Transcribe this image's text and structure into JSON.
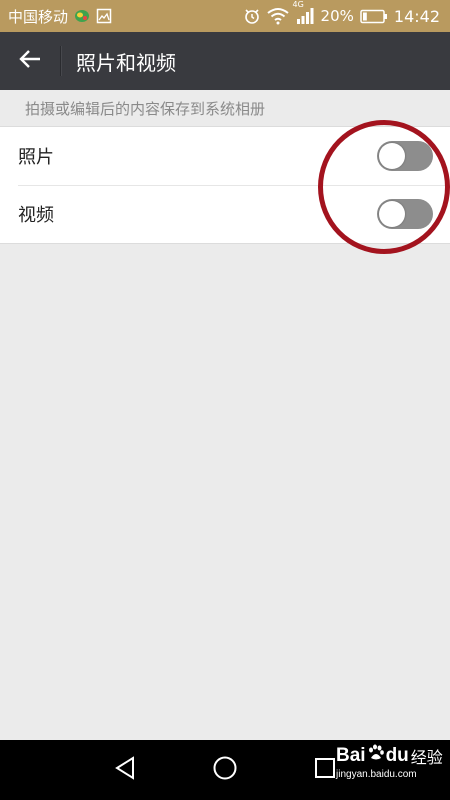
{
  "status_bar": {
    "carrier": "中国移动",
    "network_label": "4G",
    "battery_percent": "20%",
    "battery_level": 0.2,
    "time": "14:42"
  },
  "app_bar": {
    "back_icon": "arrow-left",
    "title": "照片和视频"
  },
  "section_hint": "拍摄或编辑后的内容保存到系统相册",
  "settings": [
    {
      "label": "照片",
      "enabled": false
    },
    {
      "label": "视频",
      "enabled": false
    }
  ],
  "annotation": {
    "color": "#a3131e"
  },
  "nav_bar": {
    "back_icon": "triangle-back",
    "home_icon": "circle-home",
    "recents_icon": "square-recents"
  },
  "watermark": {
    "brand_left": "Bai",
    "brand_right": "du",
    "brand_cn": "经验",
    "url": "jingyan.baidu.com"
  },
  "colors": {
    "status_bar": "#b99a5f",
    "app_bar": "#393a3f",
    "background": "#ebebeb",
    "toggle_off": "#8d8d8d"
  }
}
